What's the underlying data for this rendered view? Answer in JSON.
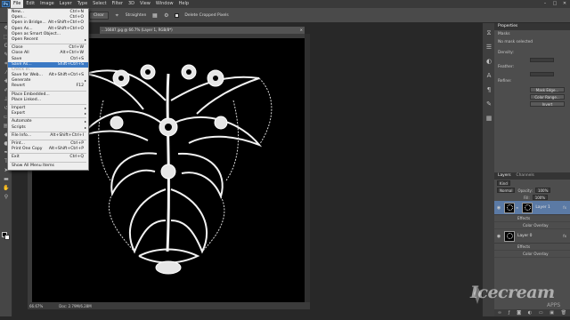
{
  "menubar": {
    "logo": "Ps",
    "items": [
      "File",
      "Edit",
      "Image",
      "Layer",
      "Type",
      "Select",
      "Filter",
      "3D",
      "View",
      "Window",
      "Help"
    ],
    "window_controls": [
      "–",
      "□",
      "✕"
    ]
  },
  "optionsbar": {
    "clear_label": "Clear",
    "straighten_label": "Straighten",
    "delete_cropped_label": "Delete Cropped Pixels"
  },
  "file_menu": {
    "items": [
      {
        "label": "New...",
        "shortcut": "Ctrl+N"
      },
      {
        "label": "Open...",
        "shortcut": "Ctrl+O"
      },
      {
        "label": "Open in Bridge...",
        "shortcut": "Alt+Shift+Ctrl+O"
      },
      {
        "label": "Open As...",
        "shortcut": "Alt+Shift+Ctrl+O"
      },
      {
        "label": "Open as Smart Object...",
        "shortcut": ""
      },
      {
        "label": "Open Recent",
        "shortcut": "",
        "submenu": true
      },
      {
        "sep": true
      },
      {
        "label": "Close",
        "shortcut": "Ctrl+W"
      },
      {
        "label": "Close All",
        "shortcut": "Alt+Ctrl+W"
      },
      {
        "label": "Save",
        "shortcut": "Ctrl+S"
      },
      {
        "label": "Save As...",
        "shortcut": "Shift+Ctrl+S",
        "highlight": true
      },
      {
        "label": "Check In...",
        "shortcut": "",
        "disabled": true
      },
      {
        "label": "Save for Web...",
        "shortcut": "Alt+Shift+Ctrl+S"
      },
      {
        "label": "Generate",
        "shortcut": "",
        "submenu": true
      },
      {
        "label": "Revert",
        "shortcut": "F12"
      },
      {
        "sep": true
      },
      {
        "label": "Place Embedded...",
        "shortcut": ""
      },
      {
        "label": "Place Linked...",
        "shortcut": ""
      },
      {
        "sep": true
      },
      {
        "label": "Import",
        "shortcut": "",
        "submenu": true
      },
      {
        "label": "Export",
        "shortcut": "",
        "submenu": true
      },
      {
        "sep": true
      },
      {
        "label": "Automate",
        "shortcut": "",
        "submenu": true
      },
      {
        "label": "Scripts",
        "shortcut": "",
        "submenu": true
      },
      {
        "sep": true
      },
      {
        "label": "File Info...",
        "shortcut": "Alt+Shift+Ctrl+I"
      },
      {
        "sep": true
      },
      {
        "label": "Print...",
        "shortcut": "Ctrl+P"
      },
      {
        "label": "Print One Copy",
        "shortcut": "Alt+Shift+Ctrl+P"
      },
      {
        "sep": true
      },
      {
        "label": "Exit",
        "shortcut": "Ctrl+Q"
      },
      {
        "sep": true
      },
      {
        "label": "Show All Menu Items",
        "shortcut": ""
      }
    ]
  },
  "document": {
    "tab_title": "...16687.jpg @ 66.7% (Layer 1, RGB/8*)",
    "tab_close": "×",
    "zoom": "66.67%",
    "doc_size": "Doc: 2.79M/6.28M"
  },
  "properties_panel": {
    "title": "Properties",
    "subtitle": "Masks",
    "no_mask": "No mask selected",
    "density_label": "Density:",
    "feather_label": "Feather:",
    "refine_label": "Refine:",
    "mask_edge_btn": "Mask Edge...",
    "color_range_btn": "Color Range...",
    "invert_btn": "Invert"
  },
  "layers_panel": {
    "tabs": [
      "Layers",
      "Channels"
    ],
    "kind_label": "Kind",
    "blend_mode": "Normal",
    "opacity_label": "Opacity:",
    "opacity_value": "100%",
    "fill_label": "Fill:",
    "fill_value": "100%",
    "layers": [
      {
        "name": "Layer 1",
        "selected": true,
        "effects_label": "Effects",
        "effect": "Color Overlay"
      },
      {
        "name": "Layer 0",
        "selected": false,
        "effects_label": "Effects",
        "effect": "Color Overlay"
      }
    ]
  },
  "watermark": {
    "text": "Icecream",
    "sub": "APPS"
  },
  "colors": {
    "menu_highlight": "#3b79c4",
    "canvas_bg": "#000000",
    "selected_layer": "#5b7aa5"
  }
}
